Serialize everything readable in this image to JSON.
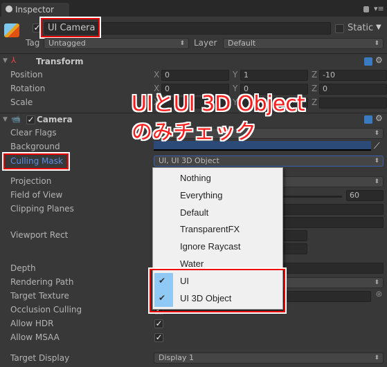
{
  "tab": {
    "title": "Inspector"
  },
  "object": {
    "name": "UI Camera",
    "active": true,
    "static_label": "Static",
    "static": false,
    "tag_label": "Tag",
    "tag": "Untagged",
    "layer_label": "Layer",
    "layer": "Default"
  },
  "transform": {
    "title": "Transform",
    "rows": [
      {
        "label": "Position",
        "x": "0",
        "y": "1",
        "z": "-10"
      },
      {
        "label": "Rotation",
        "x": "0",
        "y": "0",
        "z": "0"
      },
      {
        "label": "Scale",
        "x": "",
        "y": "",
        "z": ""
      }
    ],
    "axes": {
      "x": "X",
      "y": "Y",
      "z": "Z"
    }
  },
  "camera": {
    "title": "Camera",
    "enabled": true,
    "labels": {
      "clear_flags": "Clear Flags",
      "background": "Background",
      "culling_mask": "Culling Mask",
      "projection": "Projection",
      "fov": "Field of View",
      "clipping": "Clipping Planes",
      "viewport": "Viewport Rect",
      "depth": "Depth",
      "rendering_path": "Rendering Path",
      "target_texture": "Target Texture",
      "occlusion": "Occlusion Culling",
      "hdr": "Allow HDR",
      "msaa": "Allow MSAA",
      "target_display": "Target Display"
    },
    "background_color": "#2c4a78",
    "culling_mask": "UI, UI 3D Object",
    "fov": "60",
    "allow_hdr": true,
    "allow_msaa": true,
    "target_display": "Display 1"
  },
  "culling_menu": {
    "items": [
      {
        "label": "Nothing",
        "checked": false
      },
      {
        "label": "Everything",
        "checked": false
      },
      {
        "label": "Default",
        "checked": false
      },
      {
        "label": "TransparentFX",
        "checked": false
      },
      {
        "label": "Ignore Raycast",
        "checked": false
      },
      {
        "label": "Water",
        "checked": false
      },
      {
        "label": "UI",
        "checked": true
      },
      {
        "label": "UI 3D Object",
        "checked": true
      }
    ]
  },
  "annotation": {
    "line1": "UIとUI 3D Object",
    "line2": "のみチェック",
    "color": "#ff1a1a"
  }
}
